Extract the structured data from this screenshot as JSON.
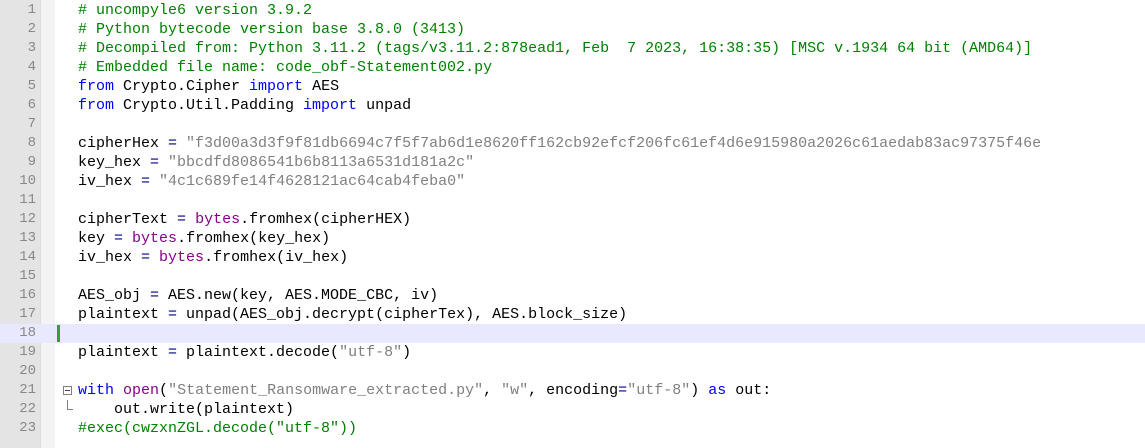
{
  "editor": {
    "current_line": 18,
    "lines": [
      {
        "n": "1",
        "parts": [
          {
            "t": "# uncompyle6 version 3.9.2",
            "c": "com"
          }
        ]
      },
      {
        "n": "2",
        "parts": [
          {
            "t": "# Python bytecode version base 3.8.0 (3413)",
            "c": "com"
          }
        ]
      },
      {
        "n": "3",
        "parts": [
          {
            "t": "# Decompiled from: Python 3.11.2 (tags/v3.11.2:878ead1, Feb  7 2023, 16:38:35) [MSC v.1934 64 bit (AMD64)]",
            "c": "com"
          }
        ]
      },
      {
        "n": "4",
        "parts": [
          {
            "t": "# Embedded file name: code_obf-Statement002.py",
            "c": "com"
          }
        ]
      },
      {
        "n": "5",
        "parts": [
          {
            "t": "from",
            "c": "kw"
          },
          {
            "t": " Crypto.Cipher ",
            "c": ""
          },
          {
            "t": "import",
            "c": "kw"
          },
          {
            "t": " AES",
            "c": ""
          }
        ]
      },
      {
        "n": "6",
        "parts": [
          {
            "t": "from",
            "c": "kw"
          },
          {
            "t": " Crypto.Util.Padding ",
            "c": ""
          },
          {
            "t": "import",
            "c": "kw"
          },
          {
            "t": " unpad",
            "c": ""
          }
        ]
      },
      {
        "n": "7",
        "parts": []
      },
      {
        "n": "8",
        "parts": [
          {
            "t": "cipherHex ",
            "c": ""
          },
          {
            "t": "=",
            "c": "op"
          },
          {
            "t": " ",
            "c": ""
          },
          {
            "t": "\"f3d00a3d3f9f81db6694c7f5f7ab6d1e8620ff162cb92efcf206fc61ef4d6e915980a2026c61aedab83ac97375f46e",
            "c": "str"
          }
        ]
      },
      {
        "n": "9",
        "parts": [
          {
            "t": "key_hex ",
            "c": ""
          },
          {
            "t": "=",
            "c": "op"
          },
          {
            "t": " ",
            "c": ""
          },
          {
            "t": "\"bbcdfd8086541b6b8113a6531d181a2c\"",
            "c": "str"
          }
        ]
      },
      {
        "n": "10",
        "parts": [
          {
            "t": "iv_hex ",
            "c": ""
          },
          {
            "t": "=",
            "c": "op"
          },
          {
            "t": " ",
            "c": ""
          },
          {
            "t": "\"4c1c689fe14f4628121ac64cab4feba0\"",
            "c": "str"
          }
        ]
      },
      {
        "n": "11",
        "parts": []
      },
      {
        "n": "12",
        "parts": [
          {
            "t": "cipherText ",
            "c": ""
          },
          {
            "t": "=",
            "c": "op"
          },
          {
            "t": " ",
            "c": ""
          },
          {
            "t": "bytes",
            "c": "bi"
          },
          {
            "t": ".fromhex(cipherHEX)",
            "c": ""
          }
        ]
      },
      {
        "n": "13",
        "parts": [
          {
            "t": "key ",
            "c": ""
          },
          {
            "t": "=",
            "c": "op"
          },
          {
            "t": " ",
            "c": ""
          },
          {
            "t": "bytes",
            "c": "bi"
          },
          {
            "t": ".fromhex(key_hex)",
            "c": ""
          }
        ]
      },
      {
        "n": "14",
        "parts": [
          {
            "t": "iv_hex ",
            "c": ""
          },
          {
            "t": "=",
            "c": "op"
          },
          {
            "t": " ",
            "c": ""
          },
          {
            "t": "bytes",
            "c": "bi"
          },
          {
            "t": ".fromhex(iv_hex)",
            "c": ""
          }
        ]
      },
      {
        "n": "15",
        "parts": []
      },
      {
        "n": "16",
        "parts": [
          {
            "t": "AES_obj ",
            "c": ""
          },
          {
            "t": "=",
            "c": "op"
          },
          {
            "t": " AES.new(key, AES.MODE_CBC, iv)",
            "c": ""
          }
        ]
      },
      {
        "n": "17",
        "parts": [
          {
            "t": "plaintext ",
            "c": ""
          },
          {
            "t": "=",
            "c": "op"
          },
          {
            "t": " unpad(AES_obj.decrypt(cipherTex), AES.block_size)",
            "c": ""
          }
        ]
      },
      {
        "n": "18",
        "parts": []
      },
      {
        "n": "19",
        "parts": [
          {
            "t": "plaintext ",
            "c": ""
          },
          {
            "t": "=",
            "c": "op"
          },
          {
            "t": " plaintext.decode(",
            "c": ""
          },
          {
            "t": "\"utf-8\"",
            "c": "str"
          },
          {
            "t": ")",
            "c": ""
          }
        ]
      },
      {
        "n": "20",
        "parts": []
      },
      {
        "n": "21",
        "parts": [
          {
            "t": "with",
            "c": "kw"
          },
          {
            "t": " ",
            "c": ""
          },
          {
            "t": "open",
            "c": "bi"
          },
          {
            "t": "(",
            "c": ""
          },
          {
            "t": "\"Statement_Ransomware_extracted.py\"",
            "c": "str"
          },
          {
            "t": ", ",
            "c": ""
          },
          {
            "t": "\"w\"",
            "c": "str"
          },
          {
            "t": ", encoding",
            "c": ""
          },
          {
            "t": "=",
            "c": "op"
          },
          {
            "t": "\"utf-8\"",
            "c": "str"
          },
          {
            "t": ") ",
            "c": ""
          },
          {
            "t": "as",
            "c": "kw"
          },
          {
            "t": " out:",
            "c": ""
          }
        ]
      },
      {
        "n": "22",
        "parts": [
          {
            "t": "    out.write(plaintext)",
            "c": ""
          }
        ]
      },
      {
        "n": "23",
        "parts": [
          {
            "t": "#exec(cwzxnZGL.decode(\"utf-8\"))",
            "c": "com"
          }
        ]
      }
    ]
  }
}
